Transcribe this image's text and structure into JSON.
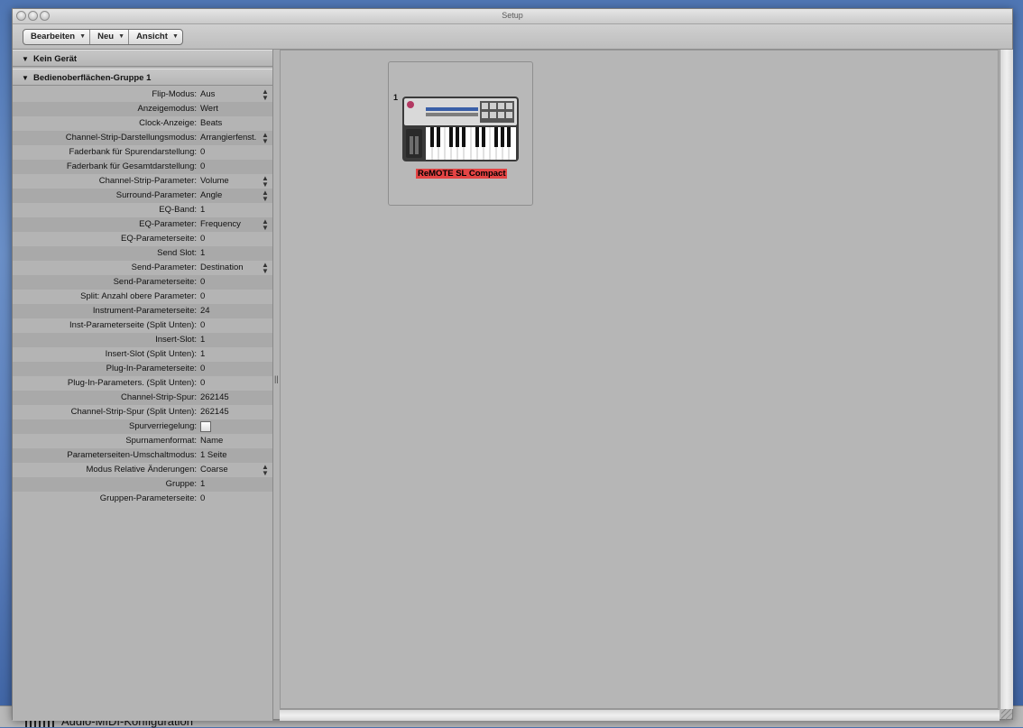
{
  "window": {
    "title": "Setup"
  },
  "toolbar": {
    "menus": [
      "Bearbeiten",
      "Neu",
      "Ansicht"
    ]
  },
  "sections": {
    "no_device": "Kein Gerät",
    "group": "Bedienoberflächen-Gruppe 1"
  },
  "params": [
    {
      "label": "Flip-Modus:",
      "value": "Aus",
      "stepper": true
    },
    {
      "label": "Anzeigemodus:",
      "value": "Wert",
      "stepper": false
    },
    {
      "label": "Clock-Anzeige:",
      "value": "Beats",
      "stepper": false
    },
    {
      "label": "Channel-Strip-Darstellungsmodus:",
      "value": "Arrangierfenst.",
      "stepper": true
    },
    {
      "label": "Faderbank für Spurendarstellung:",
      "value": "0",
      "stepper": false
    },
    {
      "label": "Faderbank für Gesamtdarstellung:",
      "value": "0",
      "stepper": false
    },
    {
      "label": "Channel-Strip-Parameter:",
      "value": "Volume",
      "stepper": true
    },
    {
      "label": "Surround-Parameter:",
      "value": "Angle",
      "stepper": true
    },
    {
      "label": "EQ-Band:",
      "value": "1",
      "stepper": false
    },
    {
      "label": "EQ-Parameter:",
      "value": "Frequency",
      "stepper": true
    },
    {
      "label": "EQ-Parameterseite:",
      "value": "0",
      "stepper": false
    },
    {
      "label": "Send Slot:",
      "value": "1",
      "stepper": false
    },
    {
      "label": "Send-Parameter:",
      "value": "Destination",
      "stepper": true
    },
    {
      "label": "Send-Parameterseite:",
      "value": "0",
      "stepper": false
    },
    {
      "label": "Split: Anzahl obere Parameter:",
      "value": "0",
      "stepper": false
    },
    {
      "label": "Instrument-Parameterseite:",
      "value": "24",
      "stepper": false
    },
    {
      "label": "Inst-Parameterseite (Split Unten):",
      "value": "0",
      "stepper": false
    },
    {
      "label": "Insert-Slot:",
      "value": "1",
      "stepper": false
    },
    {
      "label": "Insert-Slot (Split Unten):",
      "value": "1",
      "stepper": false
    },
    {
      "label": "Plug-In-Parameterseite:",
      "value": "0",
      "stepper": false
    },
    {
      "label": "Plug-In-Parameters. (Split Unten):",
      "value": "0",
      "stepper": false
    },
    {
      "label": "Channel-Strip-Spur:",
      "value": "262145",
      "stepper": false
    },
    {
      "label": "Channel-Strip-Spur (Split Unten):",
      "value": "262145",
      "stepper": false
    },
    {
      "label": "Spurverriegelung:",
      "value": "",
      "stepper": false,
      "checkbox": true
    },
    {
      "label": "Spurnamenformat:",
      "value": "Name",
      "stepper": false
    },
    {
      "label": "Parameterseiten-Umschaltmodus:",
      "value": "1 Seite",
      "stepper": false
    },
    {
      "label": "Modus Relative Änderungen:",
      "value": "Coarse",
      "stepper": true
    },
    {
      "label": "Gruppe:",
      "value": "1",
      "stepper": false
    },
    {
      "label": "Gruppen-Parameterseite:",
      "value": "0",
      "stepper": false
    }
  ],
  "device": {
    "number": "1",
    "name": "ReMOTE SL Compact"
  },
  "background_app": {
    "label": "Audio-MIDI-Konfiguration"
  },
  "icons": {
    "disclosure": "▼",
    "stepper": "▲▼"
  },
  "colors": {
    "device_label_bg": "#e44444",
    "panel_bg": "#b4b4b4"
  }
}
